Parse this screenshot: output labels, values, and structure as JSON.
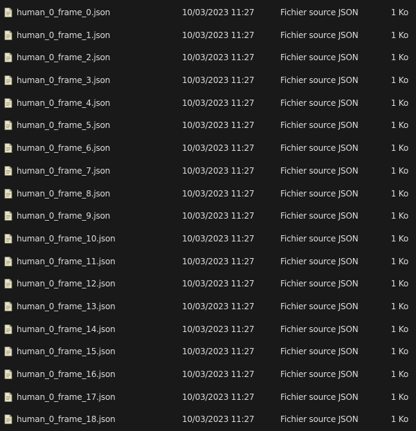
{
  "files": [
    {
      "name": "human_0_frame_0.json",
      "modified": "10/03/2023 11:27",
      "type": "Fichier source JSON",
      "size": "1 Ko"
    },
    {
      "name": "human_0_frame_1.json",
      "modified": "10/03/2023 11:27",
      "type": "Fichier source JSON",
      "size": "1 Ko"
    },
    {
      "name": "human_0_frame_2.json",
      "modified": "10/03/2023 11:27",
      "type": "Fichier source JSON",
      "size": "1 Ko"
    },
    {
      "name": "human_0_frame_3.json",
      "modified": "10/03/2023 11:27",
      "type": "Fichier source JSON",
      "size": "1 Ko"
    },
    {
      "name": "human_0_frame_4.json",
      "modified": "10/03/2023 11:27",
      "type": "Fichier source JSON",
      "size": "1 Ko"
    },
    {
      "name": "human_0_frame_5.json",
      "modified": "10/03/2023 11:27",
      "type": "Fichier source JSON",
      "size": "1 Ko"
    },
    {
      "name": "human_0_frame_6.json",
      "modified": "10/03/2023 11:27",
      "type": "Fichier source JSON",
      "size": "1 Ko"
    },
    {
      "name": "human_0_frame_7.json",
      "modified": "10/03/2023 11:27",
      "type": "Fichier source JSON",
      "size": "1 Ko"
    },
    {
      "name": "human_0_frame_8.json",
      "modified": "10/03/2023 11:27",
      "type": "Fichier source JSON",
      "size": "1 Ko"
    },
    {
      "name": "human_0_frame_9.json",
      "modified": "10/03/2023 11:27",
      "type": "Fichier source JSON",
      "size": "1 Ko"
    },
    {
      "name": "human_0_frame_10.json",
      "modified": "10/03/2023 11:27",
      "type": "Fichier source JSON",
      "size": "1 Ko"
    },
    {
      "name": "human_0_frame_11.json",
      "modified": "10/03/2023 11:27",
      "type": "Fichier source JSON",
      "size": "1 Ko"
    },
    {
      "name": "human_0_frame_12.json",
      "modified": "10/03/2023 11:27",
      "type": "Fichier source JSON",
      "size": "1 Ko"
    },
    {
      "name": "human_0_frame_13.json",
      "modified": "10/03/2023 11:27",
      "type": "Fichier source JSON",
      "size": "1 Ko"
    },
    {
      "name": "human_0_frame_14.json",
      "modified": "10/03/2023 11:27",
      "type": "Fichier source JSON",
      "size": "1 Ko"
    },
    {
      "name": "human_0_frame_15.json",
      "modified": "10/03/2023 11:27",
      "type": "Fichier source JSON",
      "size": "1 Ko"
    },
    {
      "name": "human_0_frame_16.json",
      "modified": "10/03/2023 11:27",
      "type": "Fichier source JSON",
      "size": "1 Ko"
    },
    {
      "name": "human_0_frame_17.json",
      "modified": "10/03/2023 11:27",
      "type": "Fichier source JSON",
      "size": "1 Ko"
    },
    {
      "name": "human_0_frame_18.json",
      "modified": "10/03/2023 11:27",
      "type": "Fichier source JSON",
      "size": "1 Ko"
    }
  ],
  "file_icon": "json-file-icon",
  "colors": {
    "background": "#191919",
    "text": "#dcdcdc",
    "icon_fill": "#e8e4c8",
    "icon_fold": "#b9b396"
  }
}
